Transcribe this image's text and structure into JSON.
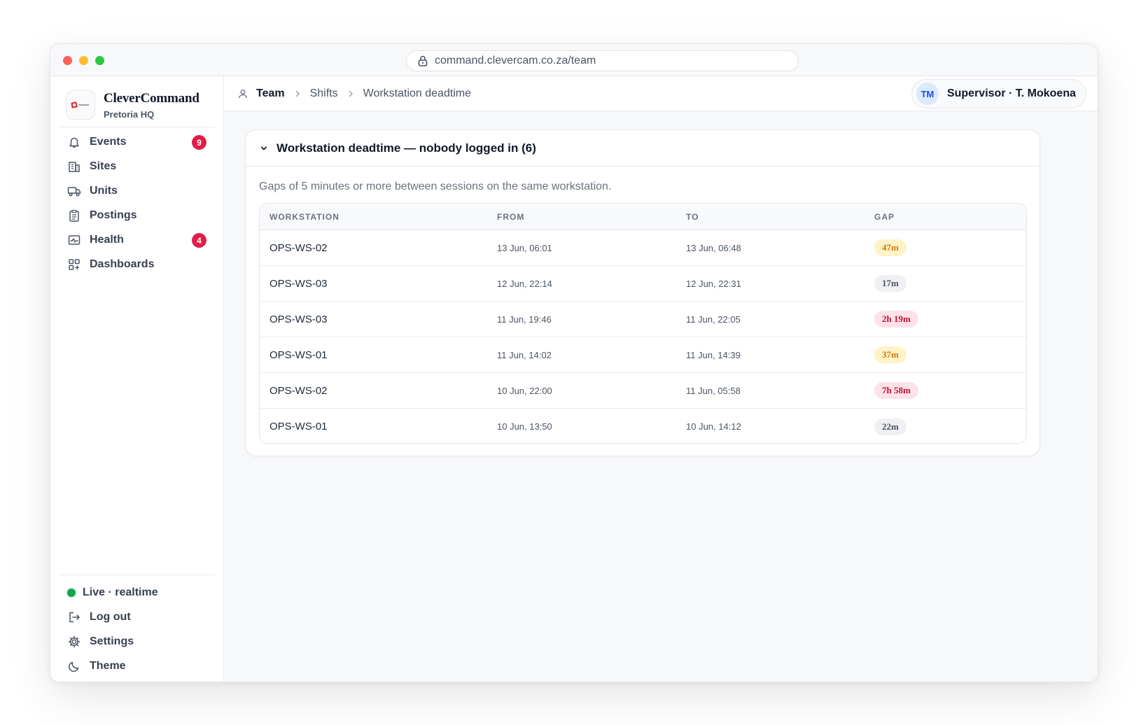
{
  "browser": {
    "url": "command.clevercam.co.za/team"
  },
  "brand": {
    "name": "CleverCommand",
    "location": "Pretoria HQ"
  },
  "nav": {
    "items": [
      {
        "label": "Events",
        "icon": "bell-icon",
        "badge": "9"
      },
      {
        "label": "Sites",
        "icon": "building-icon",
        "badge": ""
      },
      {
        "label": "Units",
        "icon": "truck-icon",
        "badge": ""
      },
      {
        "label": "Postings",
        "icon": "clipboard-icon",
        "badge": ""
      },
      {
        "label": "Health",
        "icon": "pulse-icon",
        "badge": "4"
      },
      {
        "label": "Dashboards",
        "icon": "dashboard-icon",
        "badge": ""
      }
    ],
    "footer": {
      "status": "Live · realtime",
      "logout": "Log out",
      "settings": "Settings",
      "theme": "Theme"
    }
  },
  "breadcrumb": [
    "Team",
    "Shifts",
    "Workstation deadtime"
  ],
  "user": {
    "initials": "TM",
    "label": "Supervisor · T. Mokoena"
  },
  "panel": {
    "title": "Workstation deadtime — nobody logged in (6)",
    "description": "Gaps of 5 minutes or more between sessions on the same workstation.",
    "columns": [
      "WORKSTATION",
      "FROM",
      "TO",
      "GAP"
    ],
    "rows": [
      {
        "workstation": "OPS-WS-02",
        "from": "13 Jun, 06:01",
        "to": "13 Jun, 06:48",
        "gap": "47m",
        "severity": "amber"
      },
      {
        "workstation": "OPS-WS-03",
        "from": "12 Jun, 22:14",
        "to": "12 Jun, 22:31",
        "gap": "17m",
        "severity": "grey"
      },
      {
        "workstation": "OPS-WS-03",
        "from": "11 Jun, 19:46",
        "to": "11 Jun, 22:05",
        "gap": "2h 19m",
        "severity": "red"
      },
      {
        "workstation": "OPS-WS-01",
        "from": "11 Jun, 14:02",
        "to": "11 Jun, 14:39",
        "gap": "37m",
        "severity": "amber"
      },
      {
        "workstation": "OPS-WS-02",
        "from": "10 Jun, 22:00",
        "to": "11 Jun, 05:58",
        "gap": "7h 58m",
        "severity": "red"
      },
      {
        "workstation": "OPS-WS-01",
        "from": "10 Jun, 13:50",
        "to": "10 Jun, 14:12",
        "gap": "22m",
        "severity": "grey"
      }
    ]
  },
  "colors": {
    "accent_red": "#e11d48",
    "live_green": "#16a34a",
    "pill_amber_bg": "#fef3c7",
    "pill_amber_fg": "#d97706",
    "pill_red_bg": "#fde2e7",
    "pill_red_fg": "#be123c",
    "pill_grey_bg": "#eef0f3",
    "pill_grey_fg": "#4b5563"
  }
}
